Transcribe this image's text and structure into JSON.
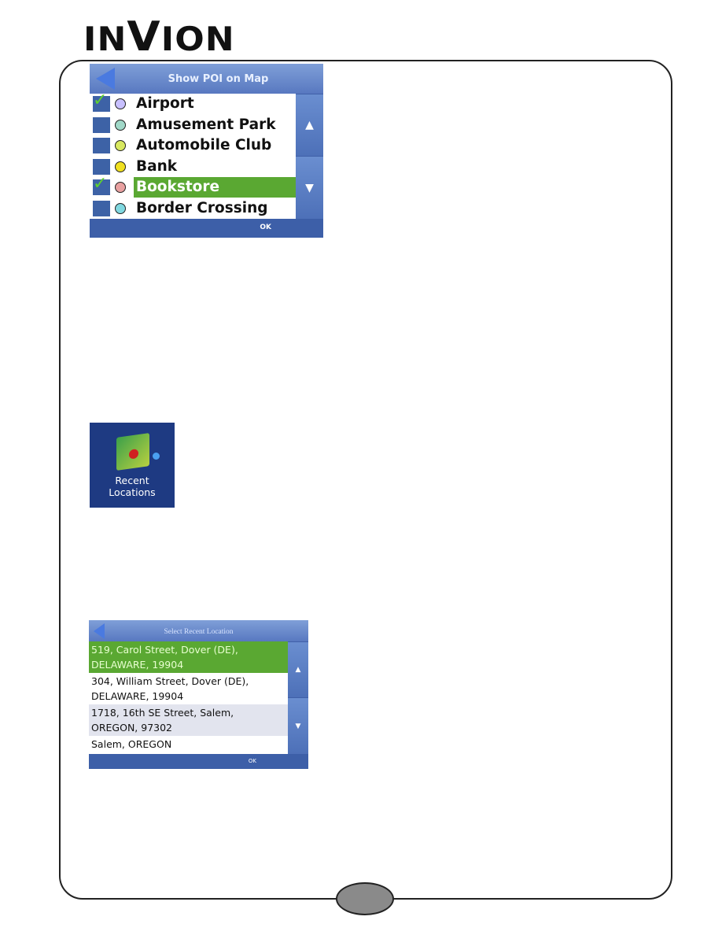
{
  "logo": "INVION",
  "page_number": "",
  "poi_screen": {
    "title": "Show POI on Map",
    "items": [
      {
        "label": "Airport",
        "checked": true,
        "icon": "airport-icon",
        "color": "#c8c0ff"
      },
      {
        "label": "Amusement Park",
        "checked": false,
        "icon": "amusement-park-icon",
        "color": "#a0d8c8"
      },
      {
        "label": "Automobile Club",
        "checked": false,
        "icon": "automobile-club-icon",
        "color": "#d8e860"
      },
      {
        "label": "Bank",
        "checked": false,
        "icon": "bank-icon",
        "color": "#f0e020"
      },
      {
        "label": "Bookstore",
        "checked": true,
        "selected": true,
        "icon": "bookstore-icon",
        "color": "#e8a0a0"
      },
      {
        "label": "Border Crossing",
        "checked": false,
        "icon": "border-crossing-icon",
        "color": "#80d8e0"
      }
    ],
    "scroll_up": "▲",
    "scroll_down": "▼",
    "ok": "OK"
  },
  "recent_icon": {
    "label_line1": "Recent",
    "label_line2": "Locations"
  },
  "recent_screen": {
    "title": "Select Recent Location",
    "items": [
      {
        "line1": "519, Carol Street, Dover (DE),",
        "line2": "DELAWARE, 19904",
        "selected": true
      },
      {
        "line1": "304, William Street, Dover (DE),",
        "line2": "DELAWARE, 19904"
      },
      {
        "line1": "1718, 16th SE Street, Salem,",
        "line2": "OREGON, 97302"
      },
      {
        "line1": "Salem, OREGON",
        "line2": ""
      }
    ],
    "scroll_up": "▲",
    "scroll_down": "▼",
    "ok": "OK"
  },
  "colors": {
    "selection": "#5aa832",
    "panel": "#5a7cc0"
  }
}
